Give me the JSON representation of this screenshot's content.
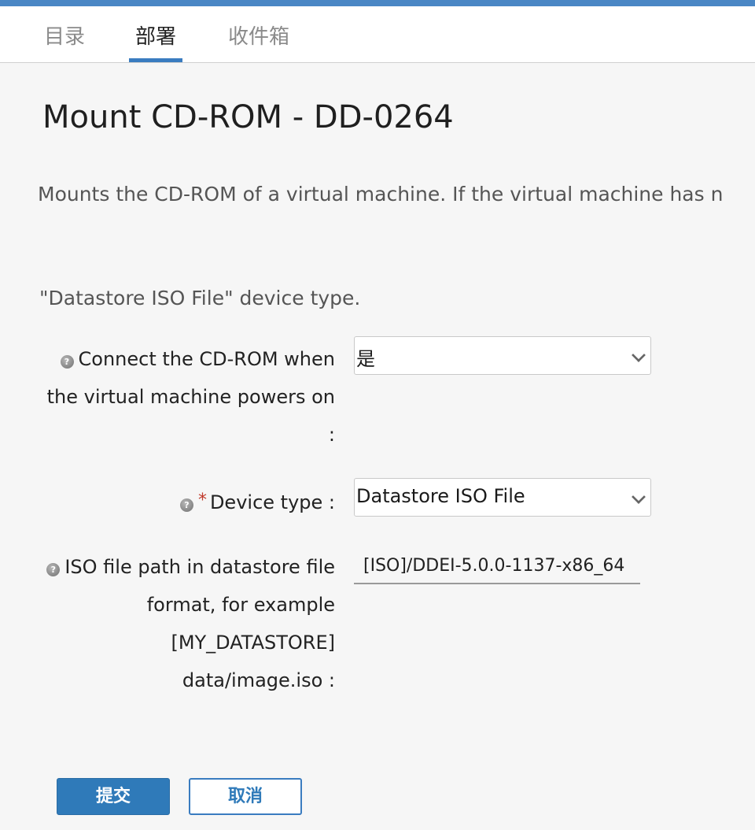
{
  "tabs": [
    {
      "label": "目录"
    },
    {
      "label": "部署"
    },
    {
      "label": "收件箱"
    }
  ],
  "dialog": {
    "title": "Mount CD-ROM - DD-0264",
    "description": "Mounts the CD-ROM of a virtual machine. If the virtual machine has n",
    "description_cont": "\"Datastore ISO File\" device type.",
    "fields": {
      "connect": {
        "label_line1": "Connect the CD-ROM when",
        "label_line2": "the virtual machine powers on",
        "label_line3": ":",
        "value": "是"
      },
      "device_type": {
        "required_mark": "*",
        "label": "Device type :",
        "value": "Datastore ISO File"
      },
      "iso_path": {
        "label_line1": "ISO file path in datastore file",
        "label_line2": "format, for example",
        "label_line3": "[MY_DATASTORE]",
        "label_line4": "data/image.iso :",
        "value": "[ISO]/DDEI-5.0.0-1137-x86_64"
      }
    },
    "buttons": {
      "submit": "提交",
      "cancel": "取消"
    }
  },
  "colors": {
    "accent": "#2f7ab9",
    "topbar": "#4a87c5",
    "required": "#c0392b"
  },
  "icons": {
    "help": "help-icon",
    "dropdown": "chevron-down-icon"
  }
}
